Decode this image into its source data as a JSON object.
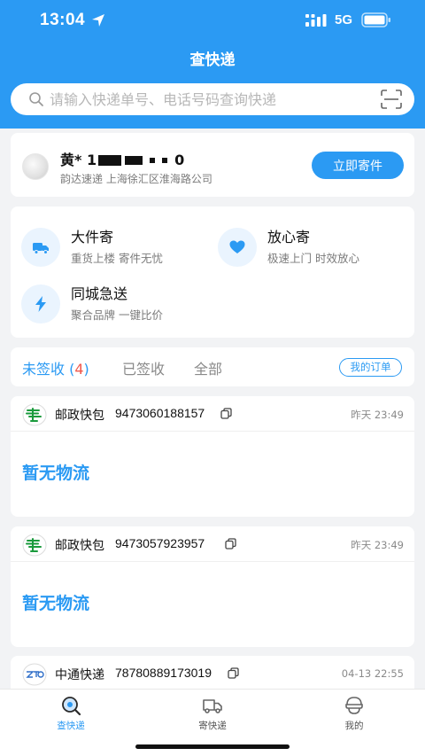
{
  "status_bar": {
    "time": "13:04",
    "network": "5G"
  },
  "page_title": "查快递",
  "search": {
    "placeholder": "请输入快递单号、电话号码查询快递",
    "value": ""
  },
  "recipient": {
    "name_prefix": "黄* 1",
    "name_suffix": "0",
    "carrier": "韵达速递",
    "branch": "上海徐汇区淮海路公司",
    "button_label": "立即寄件"
  },
  "services": [
    {
      "title": "大件寄",
      "subtitle": "重货上楼 寄件无忧",
      "icon": "truck-icon"
    },
    {
      "title": "放心寄",
      "subtitle": "极速上门 时效放心",
      "icon": "heart-icon"
    },
    {
      "title": "同城急送",
      "subtitle": "聚合品牌 一键比价",
      "icon": "lightning-icon"
    }
  ],
  "tabs": {
    "unsigned_label": "未签收",
    "unsigned_open": " (",
    "unsigned_count": "4",
    "unsigned_close": ")",
    "signed_label": "已签收",
    "all_label": "全部",
    "my_orders_label": "我的订单"
  },
  "packages": [
    {
      "carrier": "邮政快包",
      "tracking_no": "9473060188157",
      "time": "昨天 23:49",
      "status": "暂无物流",
      "logo": "china-post-logo-icon"
    },
    {
      "carrier": "邮政快包",
      "tracking_no": "9473057923957",
      "time": "昨天 23:49",
      "status": "暂无物流",
      "logo": "china-post-logo-icon"
    },
    {
      "carrier": "中通快递",
      "tracking_no": "78780889173019",
      "time": "04-13 22:55",
      "status": "",
      "logo": "zto-logo-icon"
    }
  ],
  "bottom_tabs": [
    {
      "label": "查快递",
      "icon": "search-package-icon",
      "active": true
    },
    {
      "label": "寄快递",
      "icon": "delivery-truck-icon",
      "active": false
    },
    {
      "label": "我的",
      "icon": "profile-icon",
      "active": false
    }
  ],
  "colors": {
    "primary": "#2b9af3",
    "count_red": "#f0574b",
    "background": "#f2f3f5",
    "china_post_green": "#1a9a3c"
  }
}
